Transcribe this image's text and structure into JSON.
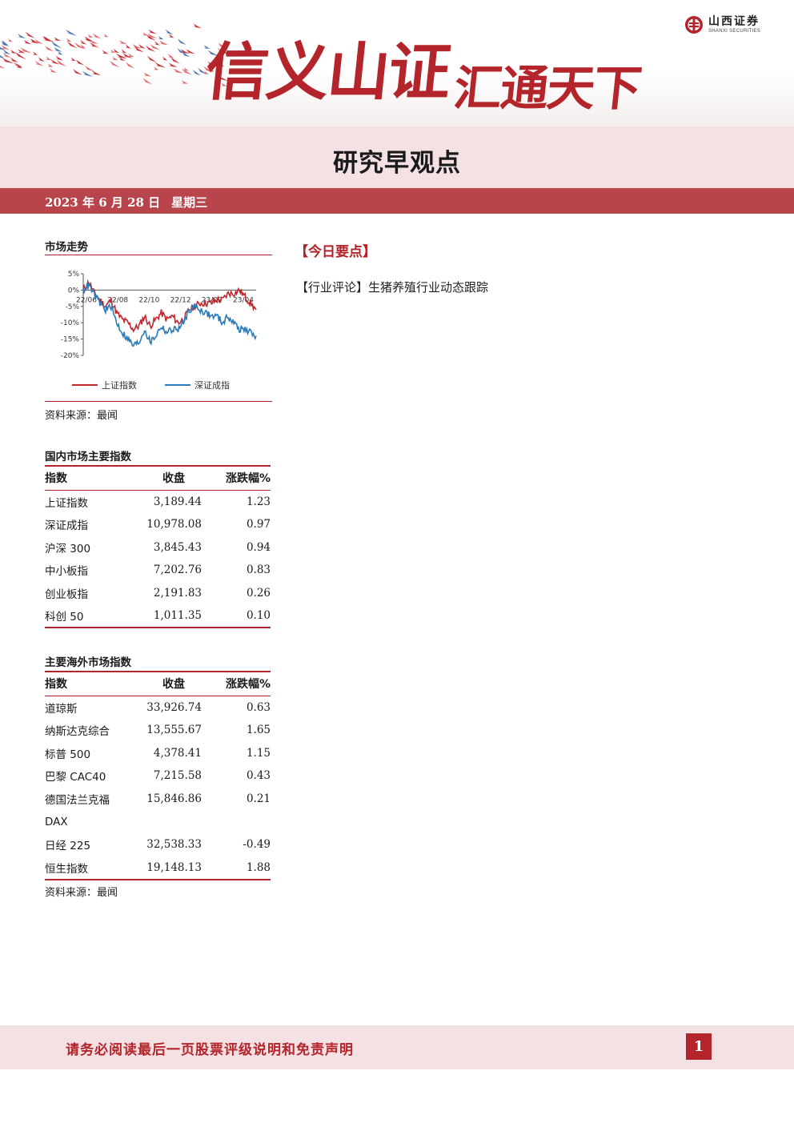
{
  "header": {
    "slogan_part1": "信义山证",
    "slogan_part2": "汇通天下",
    "logo_cn": "山西证券",
    "logo_en": "SHANXI SECURITIES"
  },
  "title": "研究早观点",
  "date": "2023 年 6 月 28 日",
  "weekday": "星期三",
  "market_trend": {
    "section_title": "市场走势",
    "source": "资料来源：最闻"
  },
  "chart_data": {
    "type": "line",
    "title": "",
    "x_ticks": [
      "22/06",
      "22/08",
      "22/10",
      "22/12",
      "23/02",
      "23/04"
    ],
    "y_ticks": [
      "5%",
      "0%",
      "-5%",
      "-10%",
      "-15%",
      "-20%"
    ],
    "ylim": [
      -20,
      5
    ],
    "colors": {
      "上证指数": "#c0282e",
      "深证成指": "#2b7bb9"
    },
    "series": [
      {
        "name": "上证指数",
        "values": [
          0,
          2.5,
          -1,
          -3,
          -5,
          -3,
          -7,
          -9,
          -10,
          -12,
          -11,
          -8,
          -11,
          -9,
          -7,
          -9,
          -8,
          -10,
          -9,
          -6,
          -5,
          -4,
          -4,
          -4,
          -3,
          -3,
          -1,
          -1,
          0,
          -2,
          -4,
          -6
        ]
      },
      {
        "name": "深证成指",
        "values": [
          0,
          1.5,
          -1.5,
          -4,
          -6,
          -5,
          -10,
          -13,
          -15,
          -17,
          -16,
          -12,
          -16,
          -14,
          -11,
          -13,
          -12,
          -12,
          -10,
          -6,
          -5,
          -6,
          -7,
          -8,
          -8,
          -10,
          -8,
          -10,
          -12,
          -12,
          -13,
          -14
        ]
      }
    ]
  },
  "domestic": {
    "section_title": "国内市场主要指数",
    "headers": [
      "指数",
      "收盘",
      "涨跌幅%"
    ],
    "rows": [
      {
        "name": "上证指数",
        "close": "3,189.44",
        "change": "1.23"
      },
      {
        "name": "深证成指",
        "close": "10,978.08",
        "change": "0.97"
      },
      {
        "name": "沪深 300",
        "close": "3,845.43",
        "change": "0.94"
      },
      {
        "name": "中小板指",
        "close": "7,202.76",
        "change": "0.83"
      },
      {
        "name": "创业板指",
        "close": "2,191.83",
        "change": "0.26"
      },
      {
        "name": "科创 50",
        "close": "1,011.35",
        "change": "0.10"
      }
    ]
  },
  "overseas": {
    "section_title": "主要海外市场指数",
    "headers": [
      "指数",
      "收盘",
      "涨跌幅%"
    ],
    "rows": [
      {
        "name": "道琼斯",
        "close": "33,926.74",
        "change": "0.63"
      },
      {
        "name": "纳斯达克综合",
        "close": "13,555.67",
        "change": "1.65"
      },
      {
        "name": "标普 500",
        "close": "4,378.41",
        "change": "1.15"
      },
      {
        "name": "巴黎 CAC40",
        "close": "7,215.58",
        "change": "0.43"
      },
      {
        "name": "德国法兰克福",
        "close": "15,846.86",
        "change": "0.21"
      },
      {
        "name": "DAX",
        "close": "",
        "change": ""
      },
      {
        "name": "日经 225",
        "close": "32,538.33",
        "change": "-0.49"
      },
      {
        "name": "恒生指数",
        "close": "19,148.13",
        "change": "1.88"
      }
    ],
    "source": "资料来源：最闻"
  },
  "highlights": {
    "title": "【今日要点】",
    "items": [
      "【行业评论】生猪养殖行业动态跟踪"
    ]
  },
  "footer": {
    "disclaimer": "请务必阅读最后一页股票评级说明和免责声明",
    "page": "1"
  }
}
